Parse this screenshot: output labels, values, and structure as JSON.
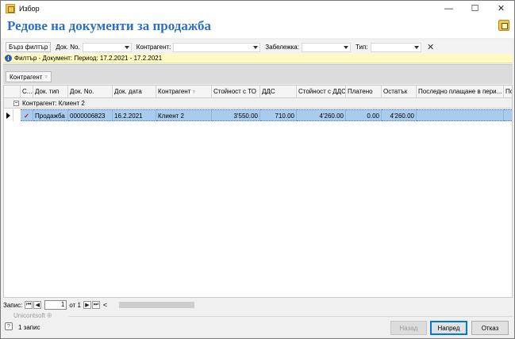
{
  "window": {
    "title": "Избор",
    "controls": {
      "minimize": "—",
      "maximize": "☐",
      "close": "✕"
    }
  },
  "header": {
    "title": "Редове на документи за продажба"
  },
  "filter_bar": {
    "quick_filter_label": "Бърз филтър",
    "doc_no_label": "Док. No.",
    "doc_no_value": "",
    "counterparty_label": "Контрагент:",
    "counterparty_value": "",
    "note_label": "Забележка:",
    "note_value": "",
    "type_label": "Тип:",
    "type_value": "",
    "clear_symbol": "✕"
  },
  "info_bar": {
    "text": "Филтър - Документ: Период: 17.2.2021 - 17.2.2021"
  },
  "group_panel": {
    "chip_label": "Контрагент"
  },
  "grid": {
    "columns": [
      {
        "label": "С..."
      },
      {
        "label": "Док. тип"
      },
      {
        "label": "Док. No."
      },
      {
        "label": "Док. дата"
      },
      {
        "label": "Контрагент"
      },
      {
        "label": "Стойност с ТО"
      },
      {
        "label": "ДДС"
      },
      {
        "label": "Стойност с ДДС"
      },
      {
        "label": "Платено"
      },
      {
        "label": "Остатък"
      },
      {
        "label": "Последно плащане в пери..."
      },
      {
        "label": "Пор"
      }
    ],
    "group_row": {
      "expander": "−",
      "label": "Контрагент: Клиент 2"
    },
    "rows": [
      {
        "checked_mark": "✓",
        "doc_type": "Продажба",
        "doc_no": "0000006823",
        "doc_date": "16.2.2021",
        "counterparty": "Клиент 2",
        "value_to": "3'550.00",
        "vat": "710.00",
        "value_with_vat": "4'260.00",
        "paid": "0.00",
        "remaining": "4'260.00",
        "last_payment": "",
        "extra": ""
      }
    ]
  },
  "navigator": {
    "label": "Запис:",
    "first": "⏮",
    "prev": "◀",
    "current": "1",
    "of_label": "от 1",
    "next": "▶",
    "last": "⏭",
    "scroll_left": "<"
  },
  "footer": {
    "brand": "Unicontsoft ®",
    "records": "1 запис",
    "back_button": "Назад",
    "next_button": "Напред",
    "cancel_button": "Отказ",
    "help_icon": "?"
  }
}
